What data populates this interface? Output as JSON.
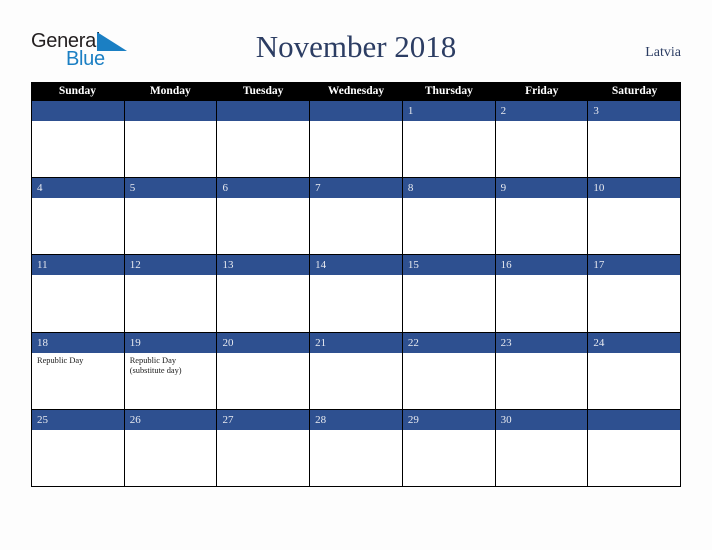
{
  "brand": {
    "word1": "General",
    "word2": "Blue",
    "triangle_color": "#1b7fc3",
    "word1_color": "#231f20",
    "word2_color": "#1b7fc3"
  },
  "header": {
    "title": "November 2018",
    "locale": "Latvia",
    "title_color": "#2c3d63"
  },
  "calendar": {
    "weekday_headers": [
      "Sunday",
      "Monday",
      "Tuesday",
      "Wednesday",
      "Thursday",
      "Friday",
      "Saturday"
    ],
    "header_bg": "#000000",
    "header_fg": "#ffffff",
    "daybar_bg": "#2e5090",
    "daybar_fg": "#e8eaf0",
    "cell_bg": "#ffffff",
    "grid_line": "#000000",
    "weeks": [
      [
        {
          "date": "",
          "events": []
        },
        {
          "date": "",
          "events": []
        },
        {
          "date": "",
          "events": []
        },
        {
          "date": "",
          "events": []
        },
        {
          "date": "1",
          "events": []
        },
        {
          "date": "2",
          "events": []
        },
        {
          "date": "3",
          "events": []
        }
      ],
      [
        {
          "date": "4",
          "events": []
        },
        {
          "date": "5",
          "events": []
        },
        {
          "date": "6",
          "events": []
        },
        {
          "date": "7",
          "events": []
        },
        {
          "date": "8",
          "events": []
        },
        {
          "date": "9",
          "events": []
        },
        {
          "date": "10",
          "events": []
        }
      ],
      [
        {
          "date": "11",
          "events": []
        },
        {
          "date": "12",
          "events": []
        },
        {
          "date": "13",
          "events": []
        },
        {
          "date": "14",
          "events": []
        },
        {
          "date": "15",
          "events": []
        },
        {
          "date": "16",
          "events": []
        },
        {
          "date": "17",
          "events": []
        }
      ],
      [
        {
          "date": "18",
          "events": [
            "Republic Day"
          ]
        },
        {
          "date": "19",
          "events": [
            "Republic Day",
            "(substitute day)"
          ]
        },
        {
          "date": "20",
          "events": []
        },
        {
          "date": "21",
          "events": []
        },
        {
          "date": "22",
          "events": []
        },
        {
          "date": "23",
          "events": []
        },
        {
          "date": "24",
          "events": []
        }
      ],
      [
        {
          "date": "25",
          "events": []
        },
        {
          "date": "26",
          "events": []
        },
        {
          "date": "27",
          "events": []
        },
        {
          "date": "28",
          "events": []
        },
        {
          "date": "29",
          "events": []
        },
        {
          "date": "30",
          "events": []
        },
        {
          "date": "",
          "events": []
        }
      ]
    ]
  }
}
